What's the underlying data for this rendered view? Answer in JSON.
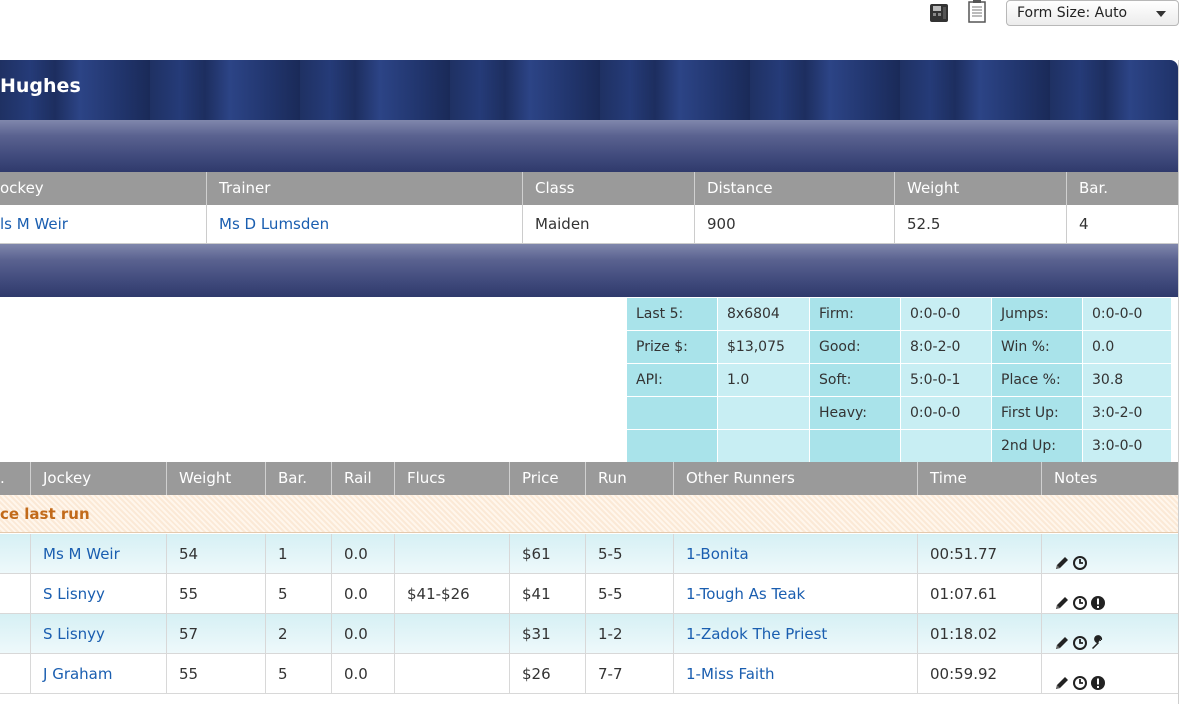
{
  "toolbar": {
    "print_icon": "print-icon",
    "doc_icon": "document-icon",
    "form_size_label": "Form Size: Auto"
  },
  "header": {
    "title": "Hughes"
  },
  "info": {
    "columns": [
      "ockey",
      "Trainer",
      "Class",
      "Distance",
      "Weight",
      "Bar."
    ],
    "values": [
      "ls M Weir",
      "Ms D Lumsden",
      "Maiden",
      "900",
      "52.5",
      "4"
    ]
  },
  "stats": {
    "rows": [
      [
        "Last 5:",
        "8x6804",
        "Firm:",
        "0:0-0-0",
        "Jumps:",
        "0:0-0-0"
      ],
      [
        "Prize $:",
        "$13,075",
        "Good:",
        "8:0-2-0",
        "Win %:",
        "0.0"
      ],
      [
        "API:",
        "1.0",
        "Soft:",
        "5:0-0-1",
        "Place %:",
        "30.8"
      ],
      [
        "",
        "",
        "Heavy:",
        "0:0-0-0",
        "First Up:",
        "3:0-2-0"
      ],
      [
        "",
        "",
        "",
        "",
        "2nd Up:",
        "3:0-0-0"
      ]
    ]
  },
  "runs": {
    "columns": [
      ".",
      "Jockey",
      "Weight",
      "Bar.",
      "Rail",
      "Flucs",
      "Price",
      "Run",
      "Other Runners",
      "Time",
      "Notes"
    ],
    "since_label": "ce last run",
    "rows": [
      {
        "jockey": "Ms M Weir",
        "weight": "54",
        "bar": "1",
        "rail": "0.0",
        "flucs": "",
        "price": "$61",
        "run": "5-5",
        "other": "1-Bonita",
        "time": "00:51.77",
        "notes": [
          "pencil-icon",
          "clock-icon"
        ]
      },
      {
        "jockey": "S Lisnyy",
        "weight": "55",
        "bar": "5",
        "rail": "0.0",
        "flucs": "$41-$26",
        "price": "$41",
        "run": "5-5",
        "other": "1-Tough As Teak",
        "time": "01:07.61",
        "notes": [
          "pencil-icon",
          "clock-icon",
          "alert-icon"
        ]
      },
      {
        "jockey": "S Lisnyy",
        "weight": "57",
        "bar": "2",
        "rail": "0.0",
        "flucs": "",
        "price": "$31",
        "run": "1-2",
        "other": "1-Zadok The Priest",
        "time": "01:18.02",
        "notes": [
          "pencil-icon",
          "clock-icon",
          "wrench-icon"
        ]
      },
      {
        "jockey": "J Graham",
        "weight": "55",
        "bar": "5",
        "rail": "0.0",
        "flucs": "",
        "price": "$26",
        "run": "7-7",
        "other": "1-Miss Faith",
        "time": "00:59.92",
        "notes": [
          "pencil-icon",
          "clock-icon",
          "alert-icon"
        ]
      }
    ]
  }
}
